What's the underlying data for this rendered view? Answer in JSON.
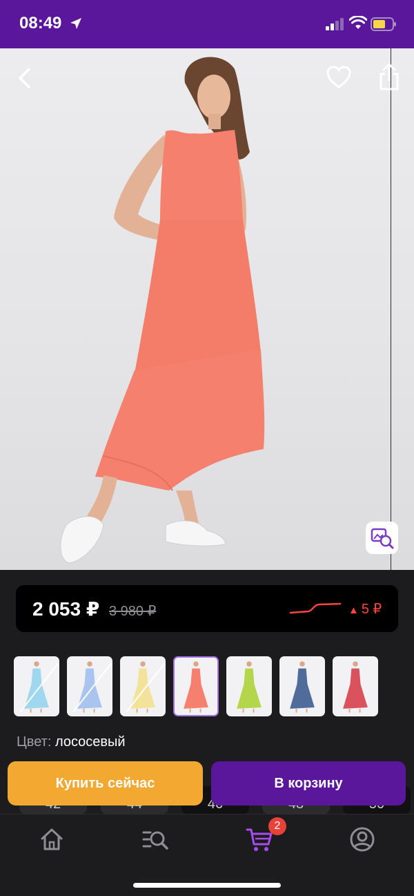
{
  "status_bar": {
    "time": "08:49",
    "icons": [
      "location-arrow-icon",
      "signal-icon",
      "wifi-icon",
      "battery-icon"
    ],
    "bg_color": "#5a179c"
  },
  "product_image": {
    "icons": [
      "back-icon",
      "heart-icon",
      "share-icon",
      "visual-search-icon"
    ],
    "dress_color": "#f5806d"
  },
  "price": {
    "current": "2 053 ₽",
    "old": "3 980 ₽",
    "change": "5 ₽",
    "change_direction": "up",
    "change_color": "#ff453a"
  },
  "color_options": [
    {
      "color": "#9fd8ee",
      "available": false
    },
    {
      "color": "#a9c4ef",
      "available": false
    },
    {
      "color": "#f3e39a",
      "available": false
    },
    {
      "color": "#f5806d",
      "available": true,
      "selected": true
    },
    {
      "color": "#b3d64a",
      "available": true
    },
    {
      "color": "#4f6c9a",
      "available": true
    },
    {
      "color": "#d9525e",
      "available": true
    }
  ],
  "color_info": {
    "label": "Цвет:",
    "value": "лососевый"
  },
  "sizes": [
    "42",
    "44",
    "46",
    "48",
    "50"
  ],
  "actions": {
    "buy_now": "Купить сейчас",
    "add_to_cart": "В корзину",
    "buy_color": "#f3a832",
    "cart_color": "#5a179c"
  },
  "tab_bar": {
    "tabs": [
      "home-icon",
      "catalog-search-icon",
      "cart-icon",
      "profile-icon"
    ],
    "active": "cart-icon",
    "cart_count": "2",
    "active_color": "#a64cf0"
  }
}
